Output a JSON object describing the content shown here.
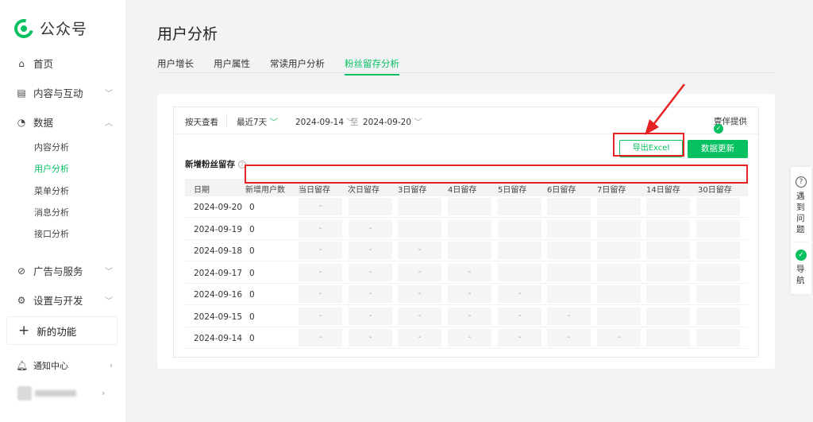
{
  "brand": {
    "name": "公众号"
  },
  "sidebar": {
    "items": [
      {
        "label": "首页",
        "icon": "home-icon"
      },
      {
        "label": "内容与互动",
        "icon": "document-icon"
      },
      {
        "label": "数据",
        "icon": "chart-icon"
      },
      {
        "label": "广告与服务",
        "icon": "compass-icon"
      },
      {
        "label": "设置与开发",
        "icon": "gear-icon"
      }
    ],
    "data_sub": [
      "内容分析",
      "用户分析",
      "菜单分析",
      "消息分析",
      "接口分析"
    ],
    "active_sub": "用户分析",
    "new_feature": "新的功能",
    "notification": "通知中心"
  },
  "page": {
    "title": "用户分析",
    "tabs": [
      "用户增长",
      "用户属性",
      "常读用户分析",
      "粉丝留存分析"
    ],
    "active_tab": "粉丝留存分析"
  },
  "filter": {
    "view_by": "按天查看",
    "range": "最近7天",
    "start": "2024-09-14",
    "to": "至",
    "end": "2024-09-20",
    "provider": "壹伴提供"
  },
  "section": {
    "title": "新增粉丝留存",
    "export_label": "导出Excel",
    "update_label": "数据更新"
  },
  "table": {
    "columns": [
      "日期",
      "新增用户数",
      "当日留存",
      "次日留存",
      "3日留存",
      "4日留存",
      "5日留存",
      "6日留存",
      "7日留存",
      "14日留存",
      "30日留存"
    ],
    "rows": [
      {
        "date": "2024-09-20",
        "new_users": "0",
        "dash_count": 1
      },
      {
        "date": "2024-09-19",
        "new_users": "0",
        "dash_count": 2
      },
      {
        "date": "2024-09-18",
        "new_users": "0",
        "dash_count": 3
      },
      {
        "date": "2024-09-17",
        "new_users": "0",
        "dash_count": 4
      },
      {
        "date": "2024-09-16",
        "new_users": "0",
        "dash_count": 5
      },
      {
        "date": "2024-09-15",
        "new_users": "0",
        "dash_count": 6
      },
      {
        "date": "2024-09-14",
        "new_users": "0",
        "dash_count": 7
      }
    ],
    "placeholder": "-"
  },
  "float_panel": {
    "help_label": "遇到问题",
    "nav_label": "导航"
  },
  "colors": {
    "accent": "#07c160",
    "annotation": "#e62222"
  }
}
